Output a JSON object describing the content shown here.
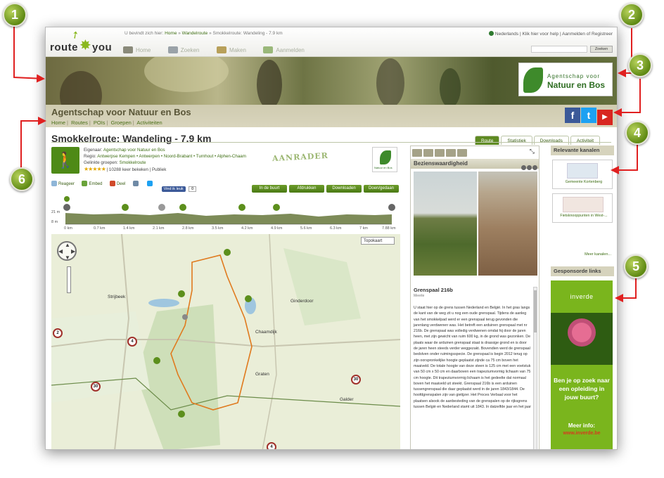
{
  "site": {
    "logo_word1": "route",
    "logo_word2": "you",
    "breadcrumb_prefix": "U bevindt zich hier:",
    "breadcrumb_items": [
      "Home",
      "Wandelroute",
      "Smokkelroute: Wandeling - 7.9 km"
    ],
    "language": "Nederlands",
    "help": "Klik hier voor help",
    "login": "Aanmelden of Registreer",
    "nav": [
      "Home",
      "Zoeken",
      "Maken",
      "Aanmelden"
    ],
    "search_button": "Zoeken"
  },
  "banner": {
    "logo_line1": "Agentschap voor",
    "logo_line2": "Natuur en Bos",
    "org_name": "Agentschap voor Natuur en Bos",
    "org_nav": [
      "Home",
      "Routes",
      "POIs",
      "Groepen",
      "Activiteiten"
    ],
    "social": [
      "f",
      "t",
      "▶"
    ]
  },
  "route": {
    "title": "Smokkelroute: Wandeling - 7.9 km",
    "tabs": [
      "Route",
      "Statistiek",
      "Downloads",
      "Activiteit"
    ],
    "owner_label": "Eigenaar:",
    "owner": "Agentschap voor Natuur en Bos",
    "region_label": "Regio:",
    "region": "Antwerpse Kempen • Antwerpen • Noord-Brabant • Turnhout • Alphen-Chaam",
    "groups_label": "Gelinkte groepen:",
    "groups": "Smokkelroute",
    "stars": "★★★★★",
    "views": "10288 keer bekeken",
    "visibility": "Publiek",
    "stamp": "AANRADER",
    "minilogo_text": "Natuur en Bos",
    "actions": [
      "Reageer",
      "Embed",
      "Deel"
    ],
    "like_label": "Vind ik leuk",
    "like_count": "0",
    "buttons": [
      "In de buurt",
      "Afdrukken",
      "Downloaden",
      "Doen/gedaan"
    ]
  },
  "profile": {
    "y_labels": [
      "21 m",
      "8 m"
    ],
    "km_labels": [
      "0 km",
      "0.7 km",
      "1.4 km",
      "2.1 km",
      "2.8 km",
      "3.5 km",
      "4.2 km",
      "4.9 km",
      "5.6 km",
      "6.3 km",
      "7 km",
      "7.88 km"
    ]
  },
  "map": {
    "type_select": "Topokaart",
    "places": [
      "Strijbeek",
      "Ginderdoor",
      "Chaamdijk",
      "Graten",
      "Galder"
    ],
    "knooppunten": [
      "2",
      "4",
      "30",
      "31",
      "30",
      "4"
    ]
  },
  "poi": {
    "header": "Bezienswaardigheid",
    "title": "Grenspaal 216b",
    "subtitle": "Meerle",
    "text": "U staat hier op de grens tussen Nederland en België. In het gras langs de kant van de weg zit u nog een oude grenspaal. Tijdens de aanleg van het smokkelpad werd er een grenspaal terug gevonden die jarenlang verdwenen was. Het betreft een arduinen grenspaal met nr 216b. De grenspaal was volledig verdwenen omdat hij door de jaren heen, met zijn gewicht van ruim 600 kg, in de grond was gezonken. De plaats waar de arduinen grenspaal staat is drassige grond en is door de jaren heen steeds verder weggezakt. Bovendien werd de grenspaal bedolven onder ruimingsspecie. De grenspaal is begin 2012 terug op zijn oorspronkelijke hoogte geplaatst zijnde ca 75 cm boven het maaiveld. De totale hoogte van deze steen is 125 cm met een voetstuk van 50 cm x 50 cm en daarboven een trapeziumvormig lichaam van 75 cm hoogte. Dit trapeziumvormig lichaam is het gedeelte dat normaal boven het maaiveld uit steekt. Grenspaal 216b is een arduinen tussengrenspaal die daar geplaatst werd in de jaren 1843/1844. De hoofdgrenspalen zijn van gietijzer. Het Proces Verbaal voor het plaatsen alsook de aanbesteding van de grenspalen op de rijksgrens tussen België en Nederland stamt uit 1843. In datzelfde jaar en het jaar"
  },
  "sidebar": {
    "channels_title": "Relevante kanalen",
    "channels": [
      "Gemeente Kortenberg",
      "Fietsknooppunten in West-..."
    ],
    "more": "Meer kanalen...",
    "sponsored_title": "Gesponsorde links",
    "ad_brand": "inverde",
    "ad_message": "Ben je op zoek naar een opleiding in jouw buurt?",
    "ad_info": "Meer info:",
    "ad_url": "www.inverde.be"
  },
  "callouts": [
    "1",
    "2",
    "3",
    "4",
    "5",
    "6"
  ]
}
